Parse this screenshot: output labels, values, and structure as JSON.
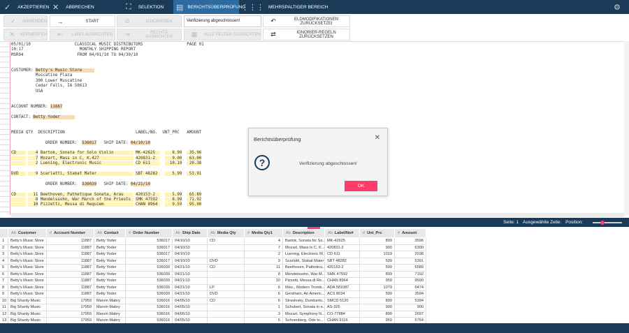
{
  "topbar": {
    "accept": "AKZEPTIEREN",
    "cancel": "ABBRECHEN",
    "selection": "SELEKTION",
    "report_check": "BERICHTSÜBERPRÜFUNG",
    "multicolumn": "MEHRSPALTIGER BEREICH"
  },
  "toolbar": {
    "apply": "ANWENDEN",
    "start": "START",
    "ignore": "IGNORIEREN",
    "status_value": "Verifizierung abgeschlossen!",
    "reset_field_mods": "ELDMODIFIKATIONEN ZURÜCKSETZEI",
    "discard": "VERWERFEN",
    "align_left": "LINKS AUSRICHTEN",
    "align_right": "RECHTS AUSRICHTEN",
    "align_all": "ALLE FELDER AUSRICHTEN",
    "reset_ignore_rules": "IGNORIER-REGELN ZURÜCKSETZEN"
  },
  "report": {
    "lines": [
      [
        [
          "05/01/10                  CLASSICAL MUSIC DISTRIBUTORS                  PAGE 01",
          ""
        ]
      ],
      [
        [
          "10:17                       MONTHLY SHIPPING REPORT",
          ""
        ]
      ],
      [
        [
          "MSR94                      FROM 04/01/10 TO 04/30/10",
          ""
        ]
      ],
      [],
      [],
      [
        [
          "CUSTOMER: ",
          ""
        ],
        [
          "Betty's Music Store     ",
          "t"
        ]
      ],
      [
        [
          "          Muscatine Plaza",
          ""
        ]
      ],
      [
        [
          "          300 Lower Muscatine",
          ""
        ]
      ],
      [
        [
          "          Cedar Falls, IA 50613",
          ""
        ]
      ],
      [
        [
          "          USA",
          ""
        ]
      ],
      [],
      [],
      [
        [
          "ACCOUNT NUMBER: ",
          ""
        ],
        [
          "11887",
          "t"
        ]
      ],
      [],
      [
        [
          "CONTACT: ",
          ""
        ],
        [
          "Betty Yoder      ",
          "t"
        ]
      ],
      [],
      [],
      [
        [
          "MEDIA QTY  DESCRIPTION                             LABEL/NO.  UNT_PRC   AMOUNT",
          ""
        ]
      ],
      [],
      [
        [
          "              ORDER NUMBER:  ",
          ""
        ],
        [
          "536017",
          "t"
        ],
        [
          "   SHIP DATE: ",
          ""
        ],
        [
          "04/10/10",
          "t"
        ]
      ],
      [],
      [
        [
          "CD    ",
          "y"
        ],
        [
          " ",
          ""
        ],
        [
          "   4",
          "y"
        ],
        [
          " ",
          ""
        ],
        [
          "Bartok, Sonata for Solo Violin        ",
          "y"
        ],
        [
          " ",
          ""
        ],
        [
          "MK-42625  ",
          "y"
        ],
        [
          "  ",
          ""
        ],
        [
          "   8.99",
          "y"
        ],
        [
          "  ",
          ""
        ],
        [
          " 35.96",
          "y"
        ]
      ],
      [
        [
          "      ",
          "y"
        ],
        [
          " ",
          ""
        ],
        [
          "   7",
          "y"
        ],
        [
          " ",
          ""
        ],
        [
          "Mozart, Mass in C, K.427              ",
          "y"
        ],
        [
          " ",
          ""
        ],
        [
          "420831-2  ",
          "y"
        ],
        [
          "  ",
          ""
        ],
        [
          "   9.00",
          "y"
        ],
        [
          "  ",
          ""
        ],
        [
          " 63.00",
          "y"
        ]
      ],
      [
        [
          "      ",
          "y"
        ],
        [
          " ",
          ""
        ],
        [
          "   2",
          "y"
        ],
        [
          " ",
          ""
        ],
        [
          "Luening, Electronic Music             ",
          "y"
        ],
        [
          " ",
          ""
        ],
        [
          "CD 611    ",
          "y"
        ],
        [
          "  ",
          ""
        ],
        [
          "  10.19",
          "y"
        ],
        [
          "  ",
          ""
        ],
        [
          " 20.38",
          "y"
        ]
      ],
      [],
      [
        [
          "DVD   ",
          "y"
        ],
        [
          " ",
          ""
        ],
        [
          "   9",
          "y"
        ],
        [
          " ",
          ""
        ],
        [
          "Scarlatti, Stabat Mater               ",
          "y"
        ],
        [
          " ",
          ""
        ],
        [
          "SBT 48282 ",
          "y"
        ],
        [
          "  ",
          ""
        ],
        [
          "   5.99",
          "y"
        ],
        [
          "  ",
          ""
        ],
        [
          " 53.91",
          "y"
        ]
      ],
      [],
      [
        [
          "              ORDER NUMBER:  ",
          ""
        ],
        [
          "536039",
          "t"
        ],
        [
          "   SHIP DATE: ",
          ""
        ],
        [
          "04/21/10",
          "t"
        ]
      ],
      [],
      [
        [
          "CD    ",
          "y"
        ],
        [
          " ",
          ""
        ],
        [
          "  11",
          "y"
        ],
        [
          " ",
          ""
        ],
        [
          "Beethoven, Pathetique Sonata, Arau    ",
          "y"
        ],
        [
          " ",
          ""
        ],
        [
          "420153-2  ",
          "y"
        ],
        [
          "  ",
          ""
        ],
        [
          "   5.99",
          "y"
        ],
        [
          "  ",
          ""
        ],
        [
          " 65.89",
          "y"
        ]
      ],
      [
        [
          "      ",
          "y"
        ],
        [
          " ",
          ""
        ],
        [
          "   8",
          "y"
        ],
        [
          " ",
          ""
        ],
        [
          "Mendelssohn, War March of the Priests ",
          "y"
        ],
        [
          " ",
          ""
        ],
        [
          "SMK 47592 ",
          "y"
        ],
        [
          "  ",
          ""
        ],
        [
          "   8.99",
          "y"
        ],
        [
          "  ",
          ""
        ],
        [
          " 71.92",
          "y"
        ]
      ],
      [
        [
          "      ",
          "y"
        ],
        [
          " ",
          ""
        ],
        [
          "  10",
          "y"
        ],
        [
          " ",
          ""
        ],
        [
          "Pizzetti, Messa di Requiem            ",
          "y"
        ],
        [
          " ",
          ""
        ],
        [
          "CHAN 8964 ",
          "y"
        ],
        [
          "  ",
          ""
        ],
        [
          "   9.59",
          "y"
        ],
        [
          "  ",
          ""
        ],
        [
          " 95.90",
          "y"
        ]
      ]
    ]
  },
  "status": {
    "page": "Seite: 1",
    "selected_row": "Ausgewählte Zeile:",
    "position": "Position:",
    "position_fraction": 0.3
  },
  "grid": {
    "columns": [
      {
        "type": "Ab",
        "label": "Customer"
      },
      {
        "type": "#",
        "label": "Account Number"
      },
      {
        "type": "Ab",
        "label": "Contact"
      },
      {
        "type": "#",
        "label": "Order Number"
      },
      {
        "type": "Ab",
        "label": "Ship Date"
      },
      {
        "type": "Ab",
        "label": "Media Qty"
      },
      {
        "type": "#",
        "label": "Media Qty1"
      },
      {
        "type": "Ab",
        "label": "Description"
      },
      {
        "type": "Ab",
        "label": "Label/No#"
      },
      {
        "type": "#",
        "label": "Unt_Prc"
      },
      {
        "type": "#",
        "label": "Amount"
      }
    ],
    "rows": [
      [
        "1",
        "Betty's Music Store",
        "11887",
        "Betty Yoder",
        "536017",
        "04/10/10",
        "CD",
        "4",
        "Bartok, Sonata for So...",
        "MK-42625",
        "899",
        "3596"
      ],
      [
        "2",
        "Betty's Music Store",
        "11887",
        "Betty Yoder",
        "536017",
        "04/10/10",
        "",
        "7",
        "Mozart, Mass in C, K...",
        "420831-2",
        "900",
        "6300"
      ],
      [
        "3",
        "Betty's Music Store",
        "11887",
        "Betty Yoder",
        "536017",
        "04/10/10",
        "",
        "2",
        "Luening, Electronic M...",
        "CD 611",
        "1019",
        "2038"
      ],
      [
        "4",
        "Betty's Music Store",
        "11887",
        "Betty Yoder",
        "536017",
        "04/10/10",
        "DVD",
        "9",
        "Scarlatti, Stabat Mater",
        "SBT 48282",
        "599",
        "5391"
      ],
      [
        "5",
        "Betty's Music Store",
        "11887",
        "Betty Yoder",
        "536039",
        "04/21/10",
        "CD",
        "11",
        "Beethoven, Patheticu...",
        "420153-2",
        "599",
        "6589"
      ],
      [
        "6",
        "Betty's Music Store",
        "11887",
        "Betty Yoder",
        "536039",
        "04/21/10",
        "",
        "8",
        "Mendelssohn, War M...",
        "SMK 47592",
        "899",
        "7192"
      ],
      [
        "7",
        "Betty's Music Store",
        "11887",
        "Betty Yoder",
        "536039",
        "04/21/10",
        "",
        "10",
        "Pizzetti, Messa di Re...",
        "CHAN 8964",
        "959",
        "9590"
      ],
      [
        "8",
        "Betty's Music Store",
        "11887",
        "Betty Yoder",
        "536039",
        "04/21/10",
        "LP",
        "6",
        "Misc., Modern Tromb...",
        "ADA 581087",
        "1079",
        "6474"
      ],
      [
        "9",
        "Betty's Music Store",
        "11887",
        "Betty Yoder",
        "536039",
        "04/21/10",
        "DVD",
        "6",
        "Gershwin, An Americ...",
        "ACS 8034",
        "599",
        "3594"
      ],
      [
        "10",
        "Big Shanty Music",
        "17959",
        "Marvin Mabry",
        "536016",
        "04/05/10",
        "CD",
        "6",
        "Stravinsky, Dumbarto...",
        "SMCD 5120",
        "899",
        "5394"
      ],
      [
        "11",
        "Big Shanty Music",
        "17959",
        "Marvin Mabry",
        "536016",
        "04/05/10",
        "",
        "1",
        "Schubert, Sonata in e...",
        "AS-325",
        "900",
        "900"
      ],
      [
        "12",
        "Big Shanty Music",
        "17959",
        "Marvin Mabry",
        "536016",
        "04/05/10",
        "",
        "3",
        "Mozart, Symphony N...",
        "CO-77884",
        "899",
        "2697"
      ],
      [
        "13",
        "Big Shanty Music",
        "17959",
        "Marvin Mabry",
        "536016",
        "04/05/10",
        "",
        "6",
        "Schoenberg, Ode to...",
        "CHAN 9116",
        "959",
        "5754"
      ]
    ]
  },
  "dialog": {
    "title": "Berichtsüberprüfung",
    "message": "Verifizierung abgeschlossen!",
    "ok": "OK"
  },
  "colors": {
    "navy": "#1b3a57",
    "accent": "#ff3d6a",
    "active_tab": "#2d6aa0"
  }
}
